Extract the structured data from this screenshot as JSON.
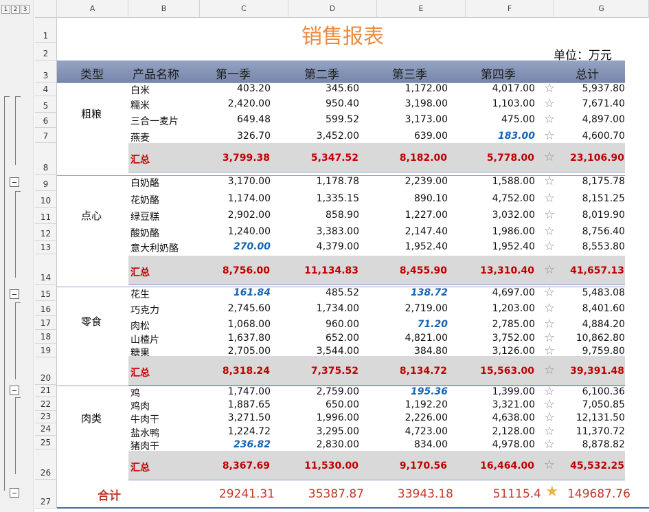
{
  "outline_levels": [
    "1",
    "2",
    "3"
  ],
  "columns": [
    "A",
    "B",
    "C",
    "D",
    "E",
    "F",
    "G"
  ],
  "row_numbers": [
    "1",
    "2",
    "3",
    "4",
    "5",
    "6",
    "7",
    "8",
    "9",
    "10",
    "11",
    "12",
    "13",
    "14",
    "15",
    "16",
    "17",
    "18",
    "19",
    "20",
    "21",
    "22",
    "23",
    "24",
    "25",
    "26",
    "27"
  ],
  "title": "销售报表",
  "unit": "单位：万元",
  "headers": [
    "类型",
    "产品名称",
    "第一季",
    "第二季",
    "第三季",
    "第四季",
    "总计"
  ],
  "groups": [
    {
      "category": "粗粮",
      "items": [
        {
          "name": "白米",
          "q1": "403.20",
          "q2": "345.60",
          "q3": "1,172.00",
          "q4": "4,017.00",
          "total": "5,937.80",
          "hl": []
        },
        {
          "name": "糯米",
          "q1": "2,420.00",
          "q2": "950.40",
          "q3": "3,198.00",
          "q4": "1,103.00",
          "total": "7,671.40",
          "hl": []
        },
        {
          "name": "三合一麦片",
          "q1": "649.48",
          "q2": "599.52",
          "q3": "3,173.00",
          "q4": "475.00",
          "total": "4,897.00",
          "hl": []
        },
        {
          "name": "燕麦",
          "q1": "326.70",
          "q2": "3,452.00",
          "q3": "639.00",
          "q4": "183.00",
          "total": "4,600.70",
          "hl": [
            "q4"
          ]
        }
      ],
      "summary": {
        "label": "汇总",
        "q1": "3,799.38",
        "q2": "5,347.52",
        "q3": "8,182.00",
        "q4": "5,778.00",
        "total": "23,106.90"
      }
    },
    {
      "category": "点心",
      "items": [
        {
          "name": "白奶酪",
          "q1": "3,170.00",
          "q2": "1,178.78",
          "q3": "2,239.00",
          "q4": "1,588.00",
          "total": "8,175.78",
          "hl": []
        },
        {
          "name": "花奶酪",
          "q1": "1,174.00",
          "q2": "1,335.15",
          "q3": "890.10",
          "q4": "4,752.00",
          "total": "8,151.25",
          "hl": []
        },
        {
          "name": "绿豆糕",
          "q1": "2,902.00",
          "q2": "858.90",
          "q3": "1,227.00",
          "q4": "3,032.00",
          "total": "8,019.90",
          "hl": []
        },
        {
          "name": "酸奶酪",
          "q1": "1,240.00",
          "q2": "3,383.00",
          "q3": "2,147.40",
          "q4": "1,986.00",
          "total": "8,756.40",
          "hl": []
        },
        {
          "name": "意大利奶酪",
          "q1": "270.00",
          "q2": "4,379.00",
          "q3": "1,952.40",
          "q4": "1,952.40",
          "total": "8,553.80",
          "hl": [
            "q1"
          ]
        }
      ],
      "summary": {
        "label": "汇总",
        "q1": "8,756.00",
        "q2": "11,134.83",
        "q3": "8,455.90",
        "q4": "13,310.40",
        "total": "41,657.13"
      }
    },
    {
      "category": "零食",
      "items": [
        {
          "name": "花生",
          "q1": "161.84",
          "q2": "485.52",
          "q3": "138.72",
          "q4": "4,697.00",
          "total": "5,483.08",
          "hl": [
            "q1",
            "q3"
          ]
        },
        {
          "name": "巧克力",
          "q1": "2,745.60",
          "q2": "1,734.00",
          "q3": "2,719.00",
          "q4": "1,203.00",
          "total": "8,401.60",
          "hl": []
        },
        {
          "name": "肉松",
          "q1": "1,068.00",
          "q2": "960.00",
          "q3": "71.20",
          "q4": "2,785.00",
          "total": "4,884.20",
          "hl": [
            "q3"
          ]
        },
        {
          "name": "山楂片",
          "q1": "1,637.80",
          "q2": "652.00",
          "q3": "4,821.00",
          "q4": "3,752.00",
          "total": "10,862.80",
          "hl": []
        },
        {
          "name": "糖果",
          "q1": "2,705.00",
          "q2": "3,544.00",
          "q3": "384.80",
          "q4": "3,126.00",
          "total": "9,759.80",
          "hl": []
        }
      ],
      "summary": {
        "label": "汇总",
        "q1": "8,318.24",
        "q2": "7,375.52",
        "q3": "8,134.72",
        "q4": "15,563.00",
        "total": "39,391.48"
      }
    },
    {
      "category": "肉类",
      "items": [
        {
          "name": "鸡",
          "q1": "1,747.00",
          "q2": "2,759.00",
          "q3": "195.36",
          "q4": "1,399.00",
          "total": "6,100.36",
          "hl": [
            "q3"
          ]
        },
        {
          "name": "鸡肉",
          "q1": "1,887.65",
          "q2": "650.00",
          "q3": "1,192.20",
          "q4": "3,321.00",
          "total": "7,050.85",
          "hl": []
        },
        {
          "name": "牛肉干",
          "q1": "3,271.50",
          "q2": "1,996.00",
          "q3": "2,226.00",
          "q4": "4,638.00",
          "total": "12,131.50",
          "hl": []
        },
        {
          "name": "盐水鸭",
          "q1": "1,224.72",
          "q2": "3,295.00",
          "q3": "4,723.00",
          "q4": "2,128.00",
          "total": "11,370.72",
          "hl": []
        },
        {
          "name": "猪肉干",
          "q1": "236.82",
          "q2": "2,830.00",
          "q3": "834.00",
          "q4": "4,978.00",
          "total": "8,878.82",
          "hl": [
            "q1"
          ]
        }
      ],
      "summary": {
        "label": "汇总",
        "q1": "8,367.69",
        "q2": "11,530.00",
        "q3": "9,170.56",
        "q4": "16,464.00",
        "total": "45,532.25"
      }
    }
  ],
  "grand_total": {
    "label": "合计",
    "q1": "29241.31",
    "q2": "35387.87",
    "q3": "33943.18",
    "q4": "51115.4",
    "total": "149687.76"
  },
  "icons": {
    "row_marker": "empty-star-icon",
    "grand_marker": "gold-star-icon"
  },
  "colors": {
    "title": "#f08a3c",
    "header_band": "#8795b8",
    "summary_text": "#c00000",
    "highlight_text": "#1464b4",
    "grand_text": "#c0392b",
    "star_gold": "#e8b54a"
  }
}
